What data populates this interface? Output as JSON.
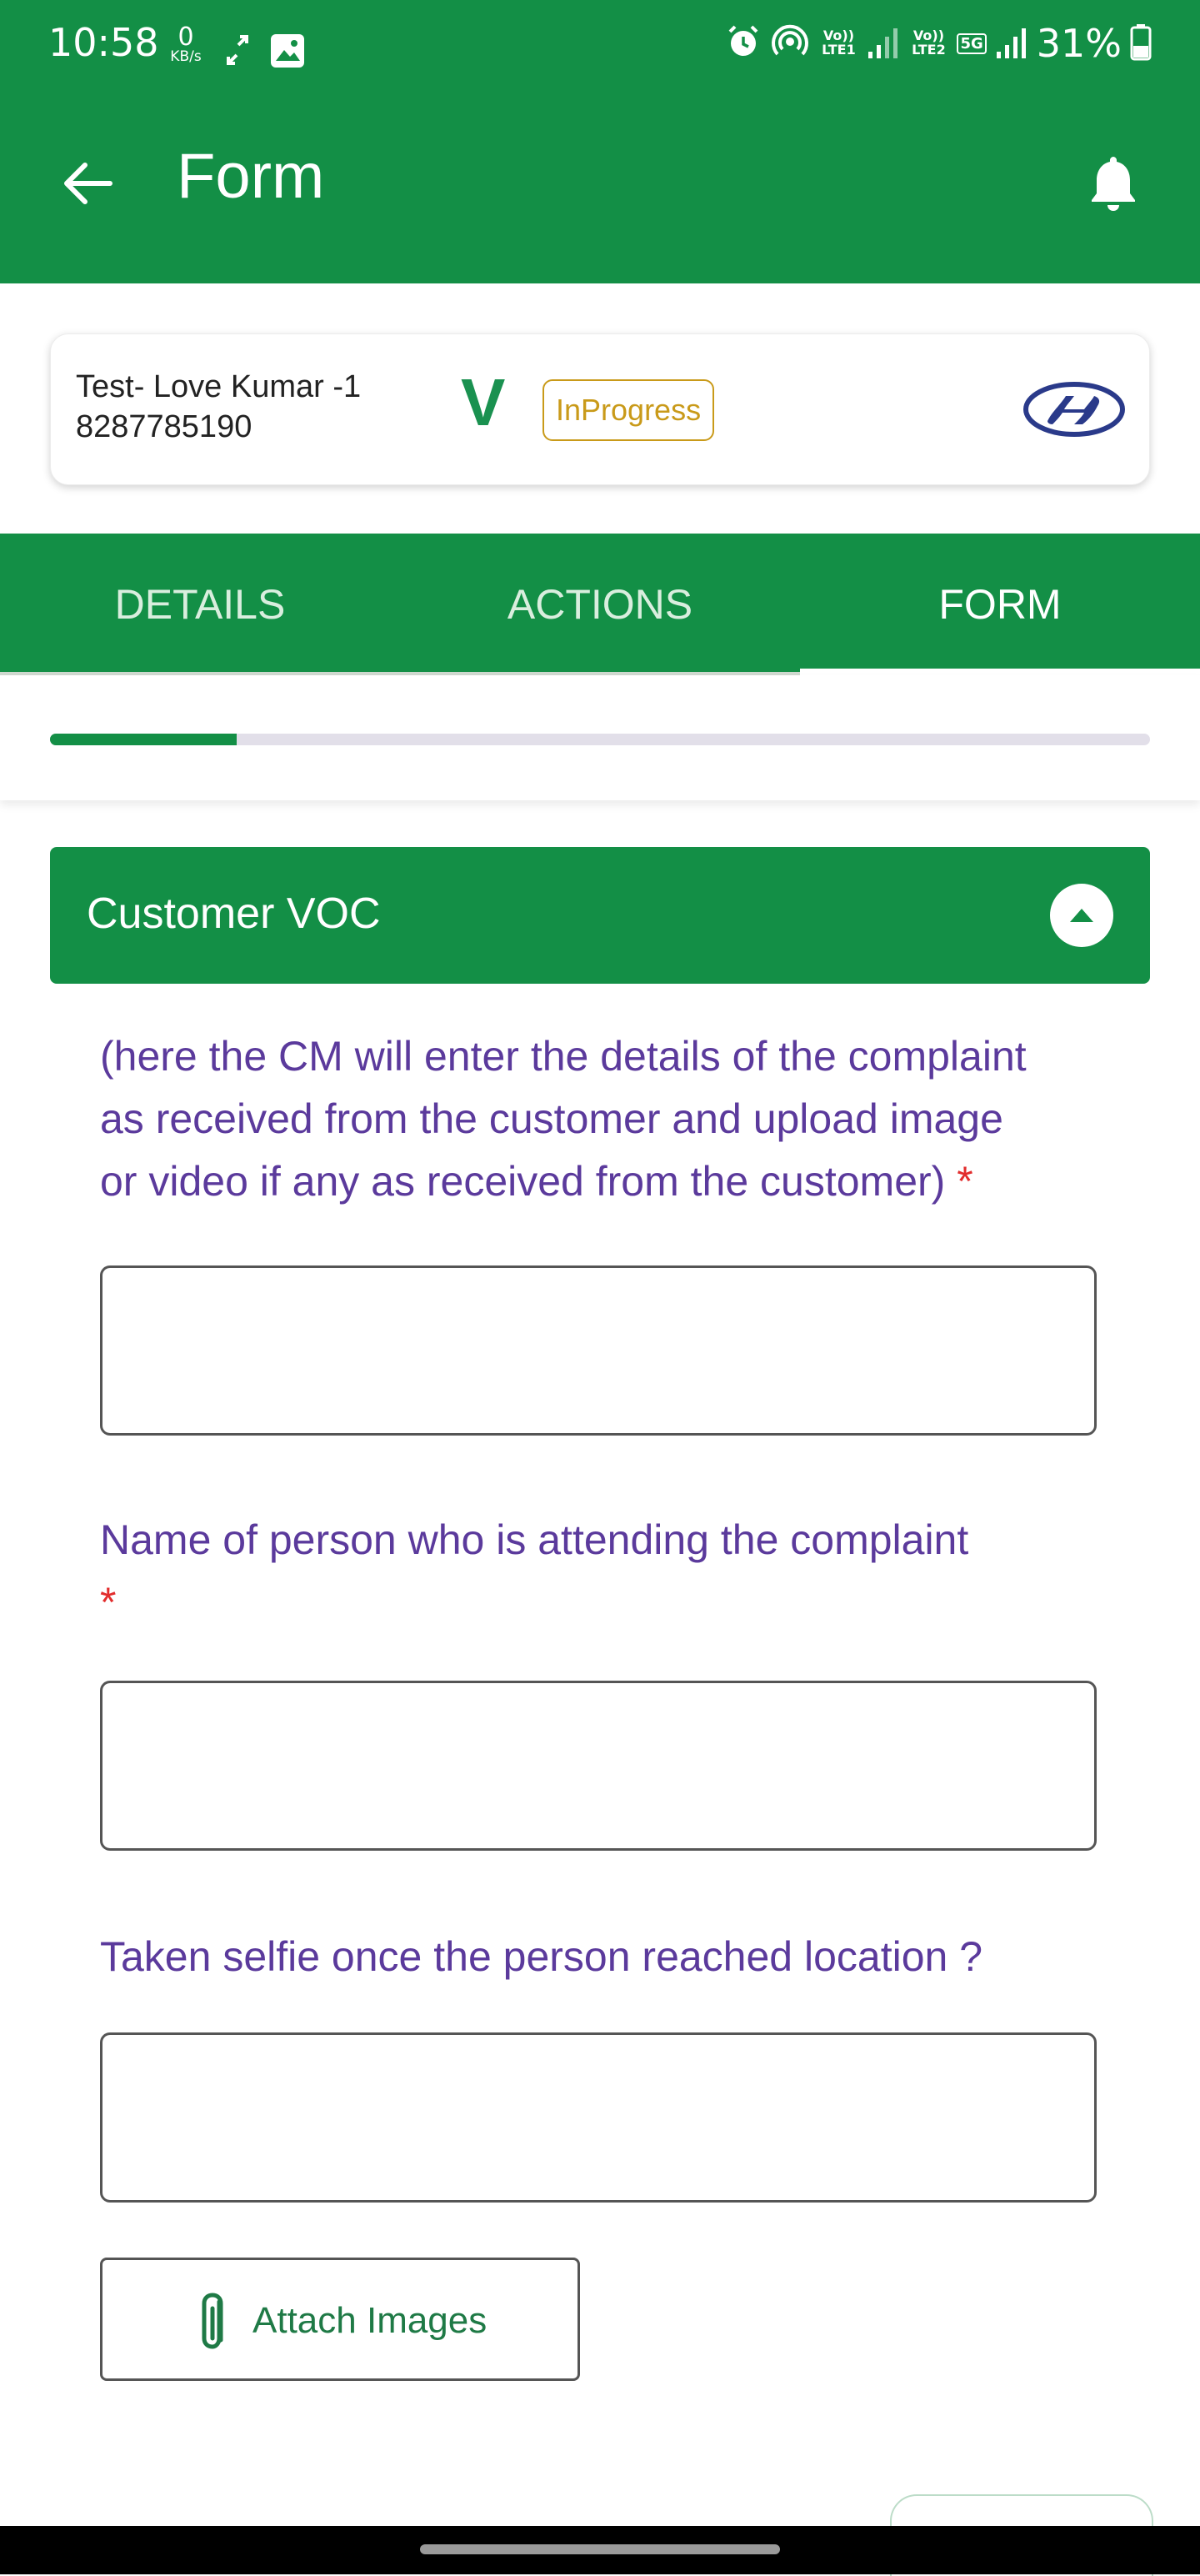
{
  "status_bar": {
    "time": "10:58",
    "speed_value": "0",
    "speed_unit": "KB/s",
    "net1": "Vo)) LTE1",
    "net2": "Vo)) LTE2",
    "net2_badge": "5G",
    "battery": "31%",
    "icons": [
      "data-arrows-icon",
      "gallery-icon",
      "alarm-icon",
      "hotspot-icon",
      "signal-icon",
      "battery-icon"
    ]
  },
  "app_bar": {
    "title": "Form",
    "back_icon": "arrow-left-icon",
    "notification_icon": "bell-icon"
  },
  "lead_card": {
    "name": "Test- Love Kumar -1",
    "phone": "8287785190",
    "mark": "V",
    "status": "InProgress",
    "brand_logo": "hyundai-logo"
  },
  "tabs": [
    {
      "label": "DETAILS",
      "active": false
    },
    {
      "label": "ACTIONS",
      "active": false
    },
    {
      "label": "FORM",
      "active": true
    }
  ],
  "progress": {
    "fraction": 0.17
  },
  "section": {
    "title": "Customer VOC",
    "collapse_icon": "chevron-up-circle-icon"
  },
  "questions": [
    {
      "lines": [
        "(here the CM will enter the details of the complaint",
        "as received from the customer and upload image",
        "or video if any as received from the customer)"
      ],
      "required_mark": "*",
      "value": ""
    },
    {
      "lines": [
        "Name of person who is attending the complaint"
      ],
      "required_mark": "*",
      "value": ""
    },
    {
      "lines": [
        "Taken selfie once the person reached location ?"
      ],
      "required_mark": "",
      "value": ""
    }
  ],
  "attach": {
    "label": "Attach Images",
    "icon": "paperclip-icon"
  },
  "colors": {
    "primary": "#138f46",
    "question_text": "#5b3a9c",
    "required": "#e22d2d",
    "status_badge": "#c99a19"
  }
}
